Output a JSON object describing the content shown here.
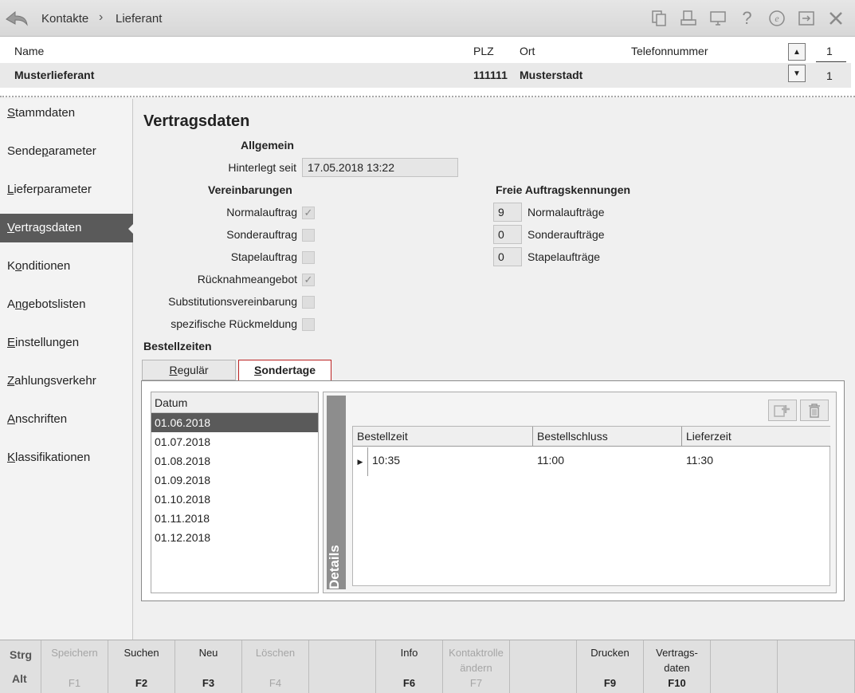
{
  "topbar": {
    "breadcrumb": [
      "Kontakte",
      "Lieferant"
    ],
    "separator": "›",
    "icons": [
      "copy-icon",
      "print-preview-icon",
      "monitor-icon",
      "help-icon",
      "e-icon",
      "export-icon",
      "close-icon"
    ]
  },
  "header": {
    "columns": {
      "name": "Name",
      "plz": "PLZ",
      "ort": "Ort",
      "telefon": "Telefonnummer"
    },
    "row": {
      "name": "Musterlieferant",
      "plz": "111111",
      "ort": "Musterstadt",
      "telefon": ""
    },
    "count_top": "1",
    "count_bottom": "1"
  },
  "nav": {
    "items": [
      {
        "pre": "",
        "u": "S",
        "post": "tammdaten"
      },
      {
        "pre": "Sende",
        "u": "p",
        "post": "arameter"
      },
      {
        "pre": "",
        "u": "L",
        "post": "ieferparameter"
      },
      {
        "pre": "",
        "u": "V",
        "post": "ertragsdaten"
      },
      {
        "pre": "K",
        "u": "o",
        "post": "nditionen"
      },
      {
        "pre": "A",
        "u": "n",
        "post": "gebotslisten"
      },
      {
        "pre": "",
        "u": "E",
        "post": "instellungen"
      },
      {
        "pre": "",
        "u": "Z",
        "post": "ahlungsverkehr"
      },
      {
        "pre": "",
        "u": "A",
        "post": "nschriften"
      },
      {
        "pre": "",
        "u": "K",
        "post": "lassifikationen"
      }
    ],
    "active_index": 3
  },
  "main": {
    "title": "Vertragsdaten",
    "allgemein": "Allgemein",
    "hinterlegt_label": "Hinterlegt seit",
    "hinterlegt_value": "17.05.2018 13:22",
    "vereinbarungen": "Vereinbarungen",
    "checks": [
      {
        "label": "Normalauftrag",
        "checked": true
      },
      {
        "label": "Sonderauftrag",
        "checked": false
      },
      {
        "label": "Stapelauftrag",
        "checked": false
      },
      {
        "label": "Rücknahmeangebot",
        "checked": true
      },
      {
        "label": "Substitutionsvereinbarung",
        "checked": false
      },
      {
        "label": "spezifische Rückmeldung",
        "checked": false
      }
    ],
    "freie_title": "Freie Auftragskennungen",
    "freie": [
      {
        "value": "9",
        "label": "Normalaufträge"
      },
      {
        "value": "0",
        "label": "Sonderaufträge"
      },
      {
        "value": "0",
        "label": "Stapelaufträge"
      }
    ],
    "bestellzeiten": "Bestellzeiten",
    "tabs": {
      "regular_u": "R",
      "regular_rest": "egulär",
      "sonder_u": "S",
      "sonder_rest": "ondertage"
    },
    "datelist": {
      "header": "Datum",
      "items": [
        "01.06.2018",
        "01.07.2018",
        "01.08.2018",
        "01.09.2018",
        "01.10.2018",
        "01.11.2018",
        "01.12.2018"
      ],
      "selected_index": 0
    },
    "details": {
      "tab_label": "Details",
      "columns": [
        "Bestellzeit",
        "Bestellschluss",
        "Lieferzeit"
      ],
      "rows": [
        [
          "10:35",
          "11:00",
          "11:30"
        ]
      ]
    }
  },
  "footer": {
    "mod1": "Strg",
    "mod2": "Alt",
    "keys": [
      {
        "label": "Speichern",
        "key": "F1",
        "enabled": false
      },
      {
        "label": "Suchen",
        "key": "F2",
        "enabled": true
      },
      {
        "label": "Neu",
        "key": "F3",
        "enabled": true
      },
      {
        "label": "Löschen",
        "key": "F4",
        "enabled": false
      },
      {
        "label": "",
        "key": "",
        "enabled": true
      },
      {
        "label": "Info",
        "key": "F6",
        "enabled": true
      },
      {
        "label": "Kontaktrolle ändern",
        "key": "F7",
        "enabled": false
      },
      {
        "label": "",
        "key": "",
        "enabled": true
      },
      {
        "label": "Drucken",
        "key": "F9",
        "enabled": true
      },
      {
        "label": "Vertrags- daten",
        "key": "F10",
        "enabled": true
      },
      {
        "label": "",
        "key": "",
        "enabled": true
      },
      {
        "label": "",
        "key": "",
        "enabled": true
      }
    ]
  }
}
